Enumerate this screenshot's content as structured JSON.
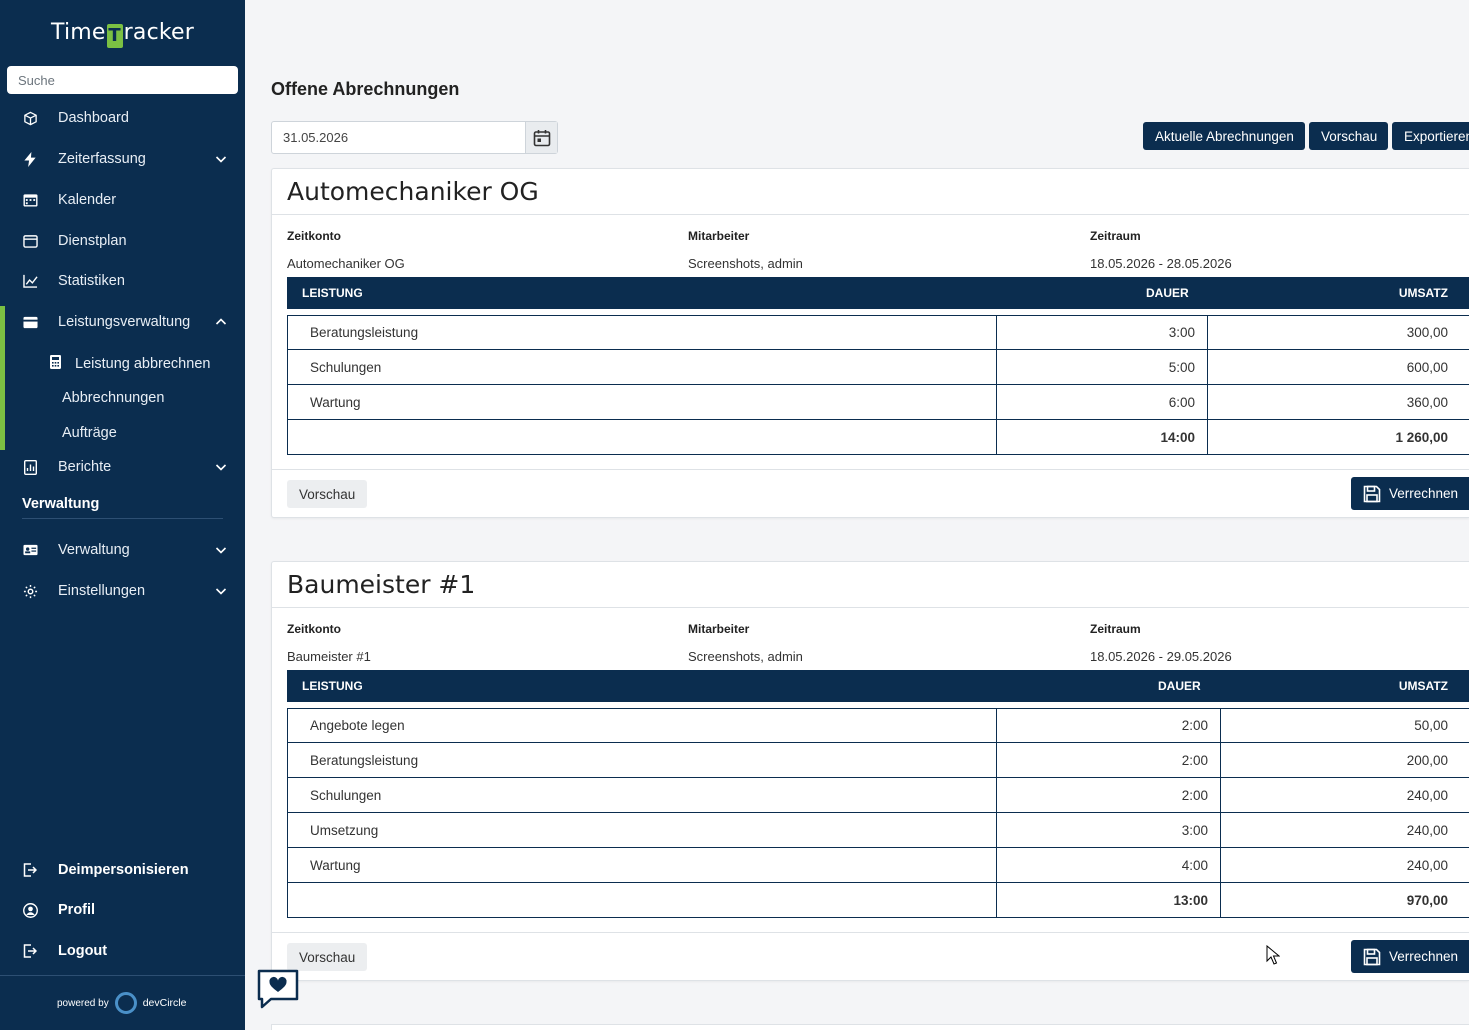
{
  "app": {
    "logo_left": "Time",
    "logo_mark": "T",
    "logo_right": "racker"
  },
  "sidebar": {
    "search_placeholder": "Suche",
    "items": [
      {
        "label": "Dashboard"
      },
      {
        "label": "Zeiterfassung"
      },
      {
        "label": "Kalender"
      },
      {
        "label": "Dienstplan"
      },
      {
        "label": "Statistiken"
      },
      {
        "label": "Leistungsverwaltung"
      },
      {
        "label": "Leistung abbrechnen"
      },
      {
        "label": "Abbrechnungen"
      },
      {
        "label": "Aufträge"
      },
      {
        "label": "Berichte"
      }
    ],
    "section_title": "Verwaltung",
    "admin_items": [
      {
        "label": "Verwaltung"
      },
      {
        "label": "Einstellungen"
      }
    ],
    "bottom_items": [
      {
        "label": "Deimpersonisieren"
      },
      {
        "label": "Profil"
      },
      {
        "label": "Logout"
      }
    ],
    "powered_by": "powered by",
    "powered_brand": "devCircle",
    "accent_color": "#7bc043",
    "bg_color": "#0b2d4f"
  },
  "main": {
    "title": "Offene Abrechnungen",
    "date_value": "31.05.2026",
    "buttons": {
      "current": "Aktuelle Abrechnungen",
      "preview": "Vorschau",
      "export": "Exportieren"
    }
  },
  "labels": {
    "zeitkonto": "Zeitkonto",
    "mitarbeiter": "Mitarbeiter",
    "zeitraum": "Zeitraum",
    "col_leistung": "LEISTUNG",
    "col_dauer": "DAUER",
    "col_umsatz": "UMSATZ",
    "vorschau": "Vorschau",
    "verrechnen": "Verrechnen"
  },
  "cards": [
    {
      "title": "Automechaniker OG",
      "zeitkonto": "Automechaniker OG",
      "mitarbeiter": "Screenshots, admin",
      "zeitraum": "18.05.2026 - 28.05.2026",
      "rows": [
        {
          "name": "Beratungsleistung",
          "dauer": "3:00",
          "umsatz": "300,00"
        },
        {
          "name": "Schulungen",
          "dauer": "5:00",
          "umsatz": "600,00"
        },
        {
          "name": "Wartung",
          "dauer": "6:00",
          "umsatz": "360,00"
        }
      ],
      "total_dauer": "14:00",
      "total_umsatz": "1 260,00"
    },
    {
      "title": "Baumeister #1",
      "zeitkonto": "Baumeister #1",
      "mitarbeiter": "Screenshots, admin",
      "zeitraum": "18.05.2026 - 29.05.2026",
      "rows": [
        {
          "name": "Angebote legen",
          "dauer": "2:00",
          "umsatz": "50,00"
        },
        {
          "name": "Beratungsleistung",
          "dauer": "2:00",
          "umsatz": "200,00"
        },
        {
          "name": "Schulungen",
          "dauer": "2:00",
          "umsatz": "240,00"
        },
        {
          "name": "Umsetzung",
          "dauer": "3:00",
          "umsatz": "240,00"
        },
        {
          "name": "Wartung",
          "dauer": "4:00",
          "umsatz": "240,00"
        }
      ],
      "total_dauer": "13:00",
      "total_umsatz": "970,00"
    }
  ]
}
